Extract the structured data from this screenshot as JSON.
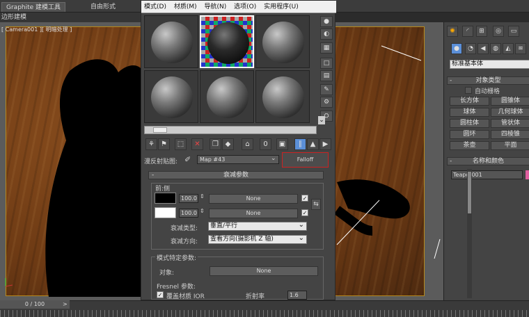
{
  "ribbon": {
    "tabs": [
      "Graphite 建模工具",
      "自由形式"
    ]
  },
  "subbar": {
    "label": "边形建模"
  },
  "viewport": {
    "label": "[ Camera001 ][ 明暗处理 ]"
  },
  "material_editor": {
    "menu": [
      "模式(D)",
      "材质(M)",
      "导航(N)",
      "选项(O)",
      "实用程序(U)"
    ],
    "map_label": "漫反射贴图:",
    "map_name": "Map #43",
    "map_type": "Falloff",
    "rollout_falloff": "衰减参数",
    "front_side": "前:侧",
    "row1": {
      "value": "100.0",
      "map": "None"
    },
    "row2": {
      "value": "100.0",
      "map": "None"
    },
    "falloff_type_label": "衰减类型:",
    "falloff_type_value": "垂直/平行",
    "falloff_dir_label": "衰减方向:",
    "falloff_dir_value": "查看方向(摄影机 Z 轴)",
    "mode_params": "模式特定参数:",
    "object_label": "对象:",
    "object_value": "None",
    "fresnel_label": "Fresnel 参数:",
    "override_ior": "覆盖材质 IOR",
    "ior_label": "折射率",
    "ior_value": "1.6"
  },
  "command_panel": {
    "dropdown": "标准基本体",
    "object_type": "对象类型",
    "autogrid": "自动栅格",
    "buttons": [
      "长方体",
      "圆锥体",
      "球体",
      "几何球体",
      "圆柱体",
      "管状体",
      "圆环",
      "四棱锥",
      "茶壶",
      "平面"
    ],
    "name_color": "名称和颜色",
    "object_name": "Teapot001"
  },
  "timeline": {
    "frame": "0 / 100"
  },
  "colors": {
    "wood": "#6d3a14",
    "selection": "#c22222",
    "accent": "#e060a0"
  }
}
